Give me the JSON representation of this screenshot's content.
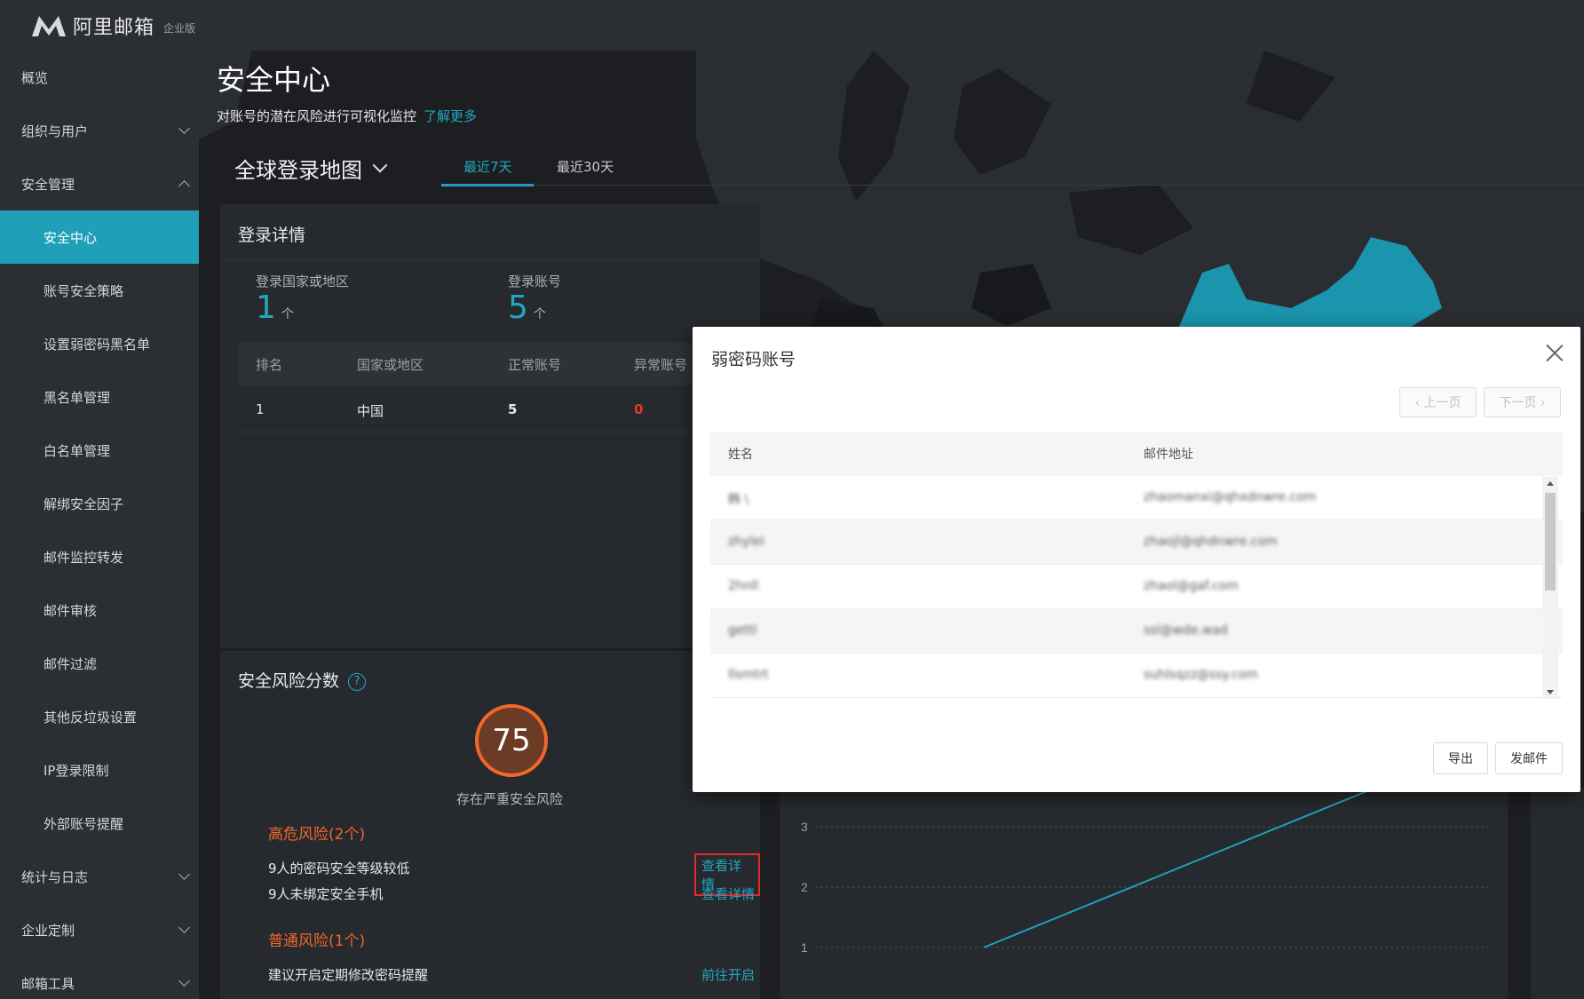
{
  "app": {
    "name": "阿里邮箱",
    "edition": "企业版"
  },
  "sidebar": {
    "items": [
      {
        "label": "概览"
      },
      {
        "label": "组织与用户"
      },
      {
        "label": "安全管理"
      },
      {
        "label": "安全中心"
      },
      {
        "label": "账号安全策略"
      },
      {
        "label": "设置弱密码黑名单"
      },
      {
        "label": "黑名单管理"
      },
      {
        "label": "白名单管理"
      },
      {
        "label": "解绑安全因子"
      },
      {
        "label": "邮件监控转发"
      },
      {
        "label": "邮件审核"
      },
      {
        "label": "邮件过滤"
      },
      {
        "label": "其他反垃圾设置"
      },
      {
        "label": "IP登录限制"
      },
      {
        "label": "外部账号提醒"
      },
      {
        "label": "统计与日志"
      },
      {
        "label": "企业定制"
      },
      {
        "label": "邮箱工具"
      }
    ]
  },
  "page": {
    "title": "安全中心",
    "description": "对账号的潜在风险进行可视化监控",
    "learn_more": "了解更多",
    "map_title": "全球登录地图",
    "tabs": [
      {
        "label": "最近7天"
      },
      {
        "label": "最近30天"
      }
    ]
  },
  "login_detail": {
    "title": "登录详情",
    "countries_label": "登录国家或地区",
    "countries_value": "1",
    "accounts_label": "登录账号",
    "accounts_value": "5",
    "unit": "个",
    "columns": [
      "排名",
      "国家或地区",
      "正常账号",
      "异常账号"
    ],
    "rows": [
      {
        "rank": "1",
        "region": "中国",
        "normal": "5",
        "abnormal": "0"
      }
    ]
  },
  "risk": {
    "title": "安全风险分数",
    "help": "?",
    "score": "75",
    "score_caption": "存在严重安全风险",
    "high_heading": "高危风险(2个)",
    "high_items": [
      {
        "text": "9人的密码安全等级较低",
        "action": "查看详情"
      },
      {
        "text": "9人未绑定安全手机",
        "action": "查看详情"
      }
    ],
    "normal_heading": "普通风险(1个)",
    "normal_items": [
      {
        "text": "建议开启定期修改密码提醒",
        "action": "前往开启"
      }
    ]
  },
  "chart_data": {
    "type": "line",
    "title": "",
    "xlabel": "",
    "ylabel": "",
    "y_ticks": [
      "3",
      "2",
      "1"
    ],
    "series": [
      {
        "values": [
          1,
          4
        ]
      }
    ],
    "color": "#1fa0b8"
  },
  "modal": {
    "title": "弱密码账号",
    "prev": "‹ 上一页",
    "next": "下一页 ›",
    "columns": [
      "姓名",
      "邮件地址"
    ],
    "rows": [
      {
        "name": "韩 \\",
        "email": "zhaomanxi@qhxdnwre.com"
      },
      {
        "name": "zhylei",
        "email": "zhaojl@qhdnwre.com"
      },
      {
        "name": "2hnll",
        "email": "zhaol@gaf.com"
      },
      {
        "name": "gettl",
        "email": "ssl@wde.wad"
      },
      {
        "name": "llsmtrt",
        "email": "suhlsqzz@ssy.com"
      }
    ],
    "export": "导出",
    "send": "发邮件"
  },
  "colors": {
    "accent": "#1fa0b8",
    "danger": "#f0672b",
    "sidebar": "#2b2e33"
  }
}
